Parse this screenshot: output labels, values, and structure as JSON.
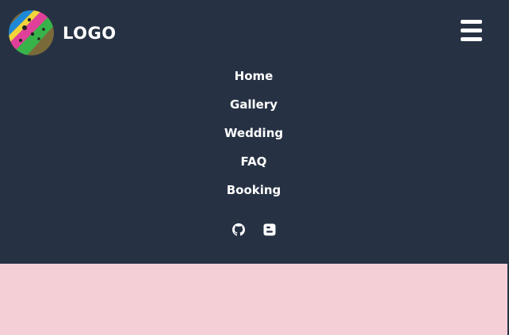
{
  "header": {
    "logo_text": "LOGO",
    "menu_icon": "hamburger-icon"
  },
  "nav": {
    "items": [
      {
        "label": "Home"
      },
      {
        "label": "Gallery"
      },
      {
        "label": "Wedding"
      },
      {
        "label": "FAQ"
      },
      {
        "label": "Booking"
      }
    ]
  },
  "social": [
    {
      "icon": "github-icon"
    },
    {
      "icon": "blogger-icon"
    }
  ],
  "colors": {
    "nav_background": "#263244",
    "page_background": "#f4d0d6",
    "text": "#ffffff"
  }
}
